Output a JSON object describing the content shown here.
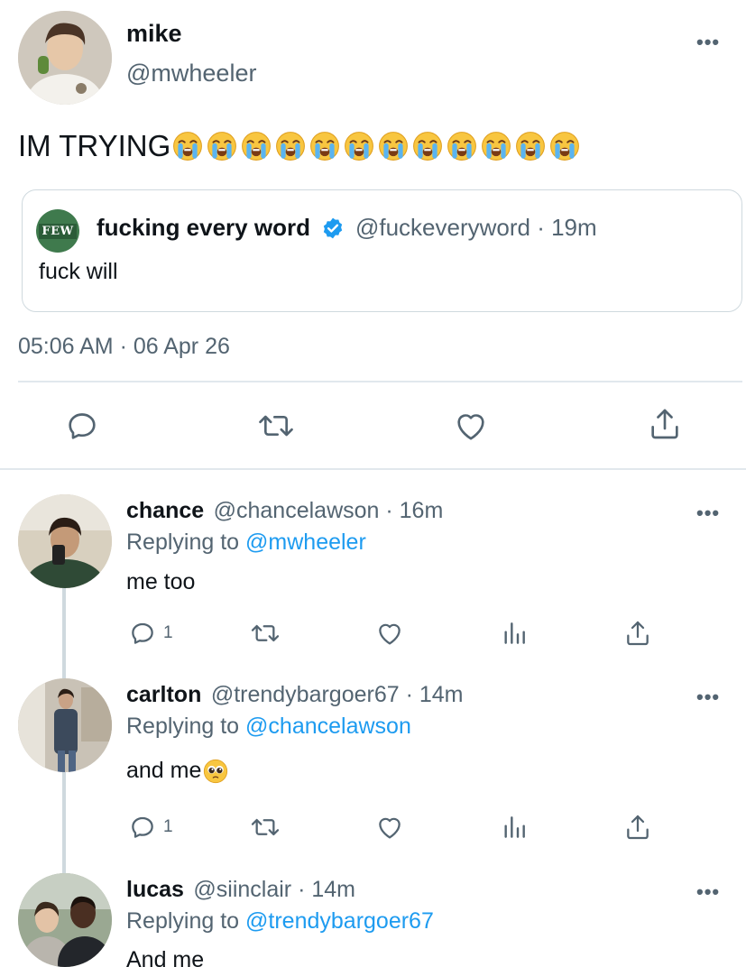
{
  "main_tweet": {
    "name": "mike",
    "handle": "@mwheeler",
    "text": "IM TRYING",
    "emoji_count": 12,
    "emoji_name": "loudly-crying-face",
    "quote": {
      "avatar_text": "FEW",
      "name": "fucking every word",
      "verified": true,
      "handle_time": "@fuckeveryword · 19m",
      "text": "fuck will"
    },
    "timestamp": "05:06 AM · 06 Apr 26",
    "actions": [
      "reply-icon",
      "retweet-icon",
      "like-icon",
      "share-icon"
    ]
  },
  "replies": [
    {
      "name": "chance",
      "handle_time": "@chancelawson · 16m",
      "replying_prefix": "Replying to ",
      "replying_to": "@mwheeler",
      "text": "me too",
      "reply_count": "1"
    },
    {
      "name": "carlton",
      "handle_time": "@trendybargoer67 · 14m",
      "replying_prefix": "Replying to ",
      "replying_to": "@chancelawson",
      "text": "and me",
      "reply_count": "1"
    },
    {
      "name": "lucas",
      "handle_time": "@siinclair · 14m",
      "replying_prefix": "Replying to ",
      "replying_to": "@trendybargoer67",
      "text": "And me"
    }
  ],
  "ui": {
    "more": "•••"
  },
  "colors": {
    "link": "#1d9bf0",
    "secondary_text": "#536471",
    "divider": "#e1e8ed",
    "quote_avatar_bg": "#3f7a4d"
  }
}
